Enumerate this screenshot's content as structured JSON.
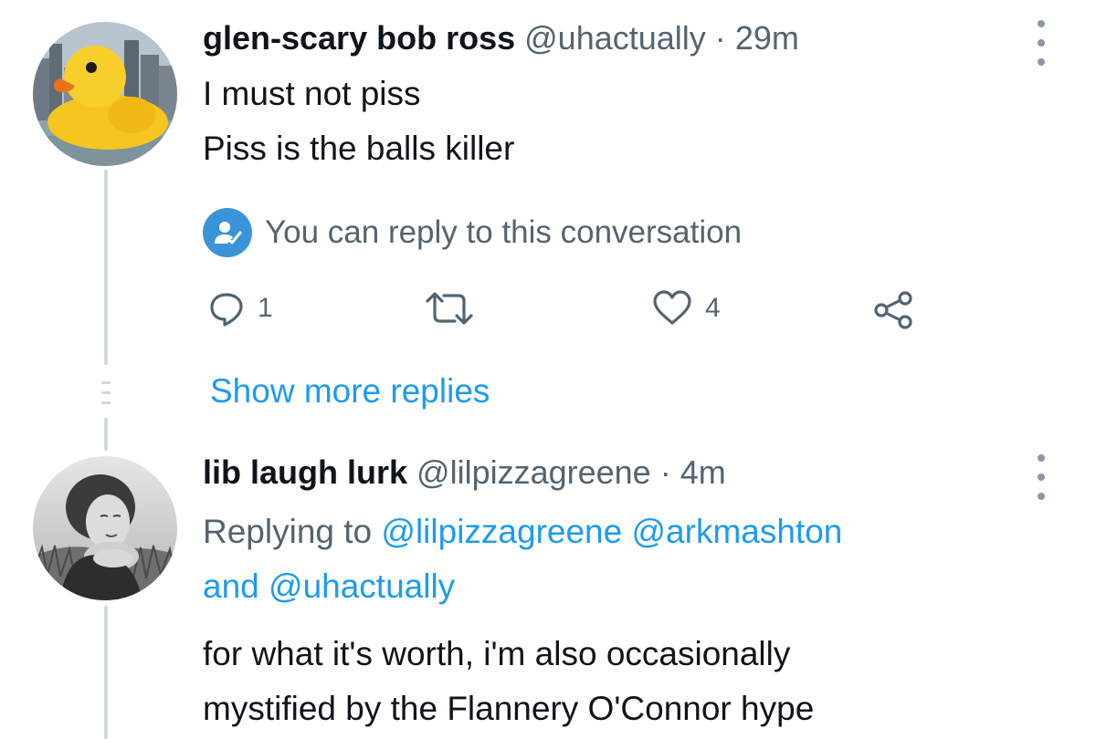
{
  "tweet1": {
    "display_name": "glen-scary bob ross",
    "handle": "@uhactually",
    "separator": "·",
    "time": "29m",
    "lines": [
      "I must not piss",
      "Piss is the balls killer"
    ],
    "avatar_icon": "rubber-duck-avatar",
    "more_icon": "more-options-icon"
  },
  "notice": {
    "icon": "reply-permission-icon",
    "text": "You can reply to this conversation"
  },
  "actions": {
    "reply_icon": "reply-icon",
    "reply_count": "1",
    "retweet_icon": "retweet-icon",
    "like_icon": "like-heart-icon",
    "like_count": "4",
    "share_icon": "share-icon"
  },
  "show_more_replies": "Show more replies",
  "tweet2": {
    "display_name": "lib laugh lurk",
    "handle": "@lilpizzagreene",
    "separator": "·",
    "time": "4m",
    "replying_prefix": "Replying to",
    "replying_handle_1": "@lilpizzagreene",
    "replying_handle_2": "@arkmashton",
    "replying_and": "and",
    "replying_handle_3": "@uhactually",
    "lines": [
      "for what it's worth, i'm also occasionally",
      "mystified by the Flannery O'Connor hype"
    ],
    "avatar_icon": "woman-portrait-avatar",
    "more_icon": "more-options-icon"
  },
  "colors": {
    "link": "#1d9bf0",
    "secondary_text": "#536471",
    "primary_text": "#0f1419",
    "thread_line": "#cfd9de"
  }
}
